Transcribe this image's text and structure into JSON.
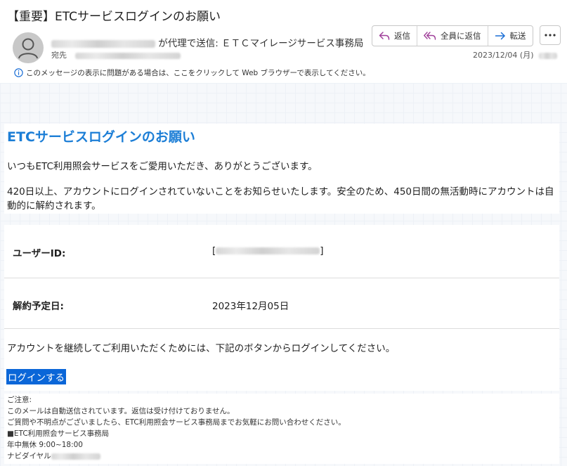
{
  "header": {
    "subject": "【重要】ETCサービスログインのお願い",
    "sender_suffix": "が代理で送信: ＥＴＣマイレージサービス事務局",
    "to_label": "宛先",
    "date": "2023/12/04 (月)",
    "info_text": "このメッセージの表示に問題がある場合は、ここをクリックして Web ブラウザーで表示してください。",
    "actions": {
      "reply": "返信",
      "reply_all": "全員に返信",
      "forward": "転送"
    },
    "colors": {
      "reply_icon": "#a0409a",
      "forward_icon": "#1c6fd6",
      "info_icon": "#1c6fd6"
    }
  },
  "mail": {
    "title": "ETCサービスログインのお願い",
    "greeting": "いつもETC利用照会サービスをご愛用いただき、ありがとうございます。",
    "notice": "420日以上、アカウントにログインされていないことをお知らせいたします。安全のため、450日間の無活動時にアカウントは自動的に解約されます。",
    "user_id_label": "ユーザーID:",
    "user_id_open": "[",
    "user_id_close": "]",
    "cancel_date_label": "解約予定日:",
    "cancel_date_value": "2023年12月05日",
    "continue_text": "アカウントを継続してご利用いただくためには、下記のボタンからログインしてください。",
    "login_button": "ログインする",
    "footer": {
      "caution": "ご注意:",
      "line1": "このメールは自動送信されています。返信は受け付けておりません。",
      "line2": "ご質問や不明点がございましたら、ETC利用照会サービス事務局までお気軽にお問い合わせください。",
      "line3": "■ETC利用照会サービス事務局",
      "line4": "年中無休 9:00~18:00",
      "line5": "ナビダイヤル"
    },
    "colors": {
      "title": "#1c7ed6",
      "login_bg": "#0a66d8"
    }
  }
}
